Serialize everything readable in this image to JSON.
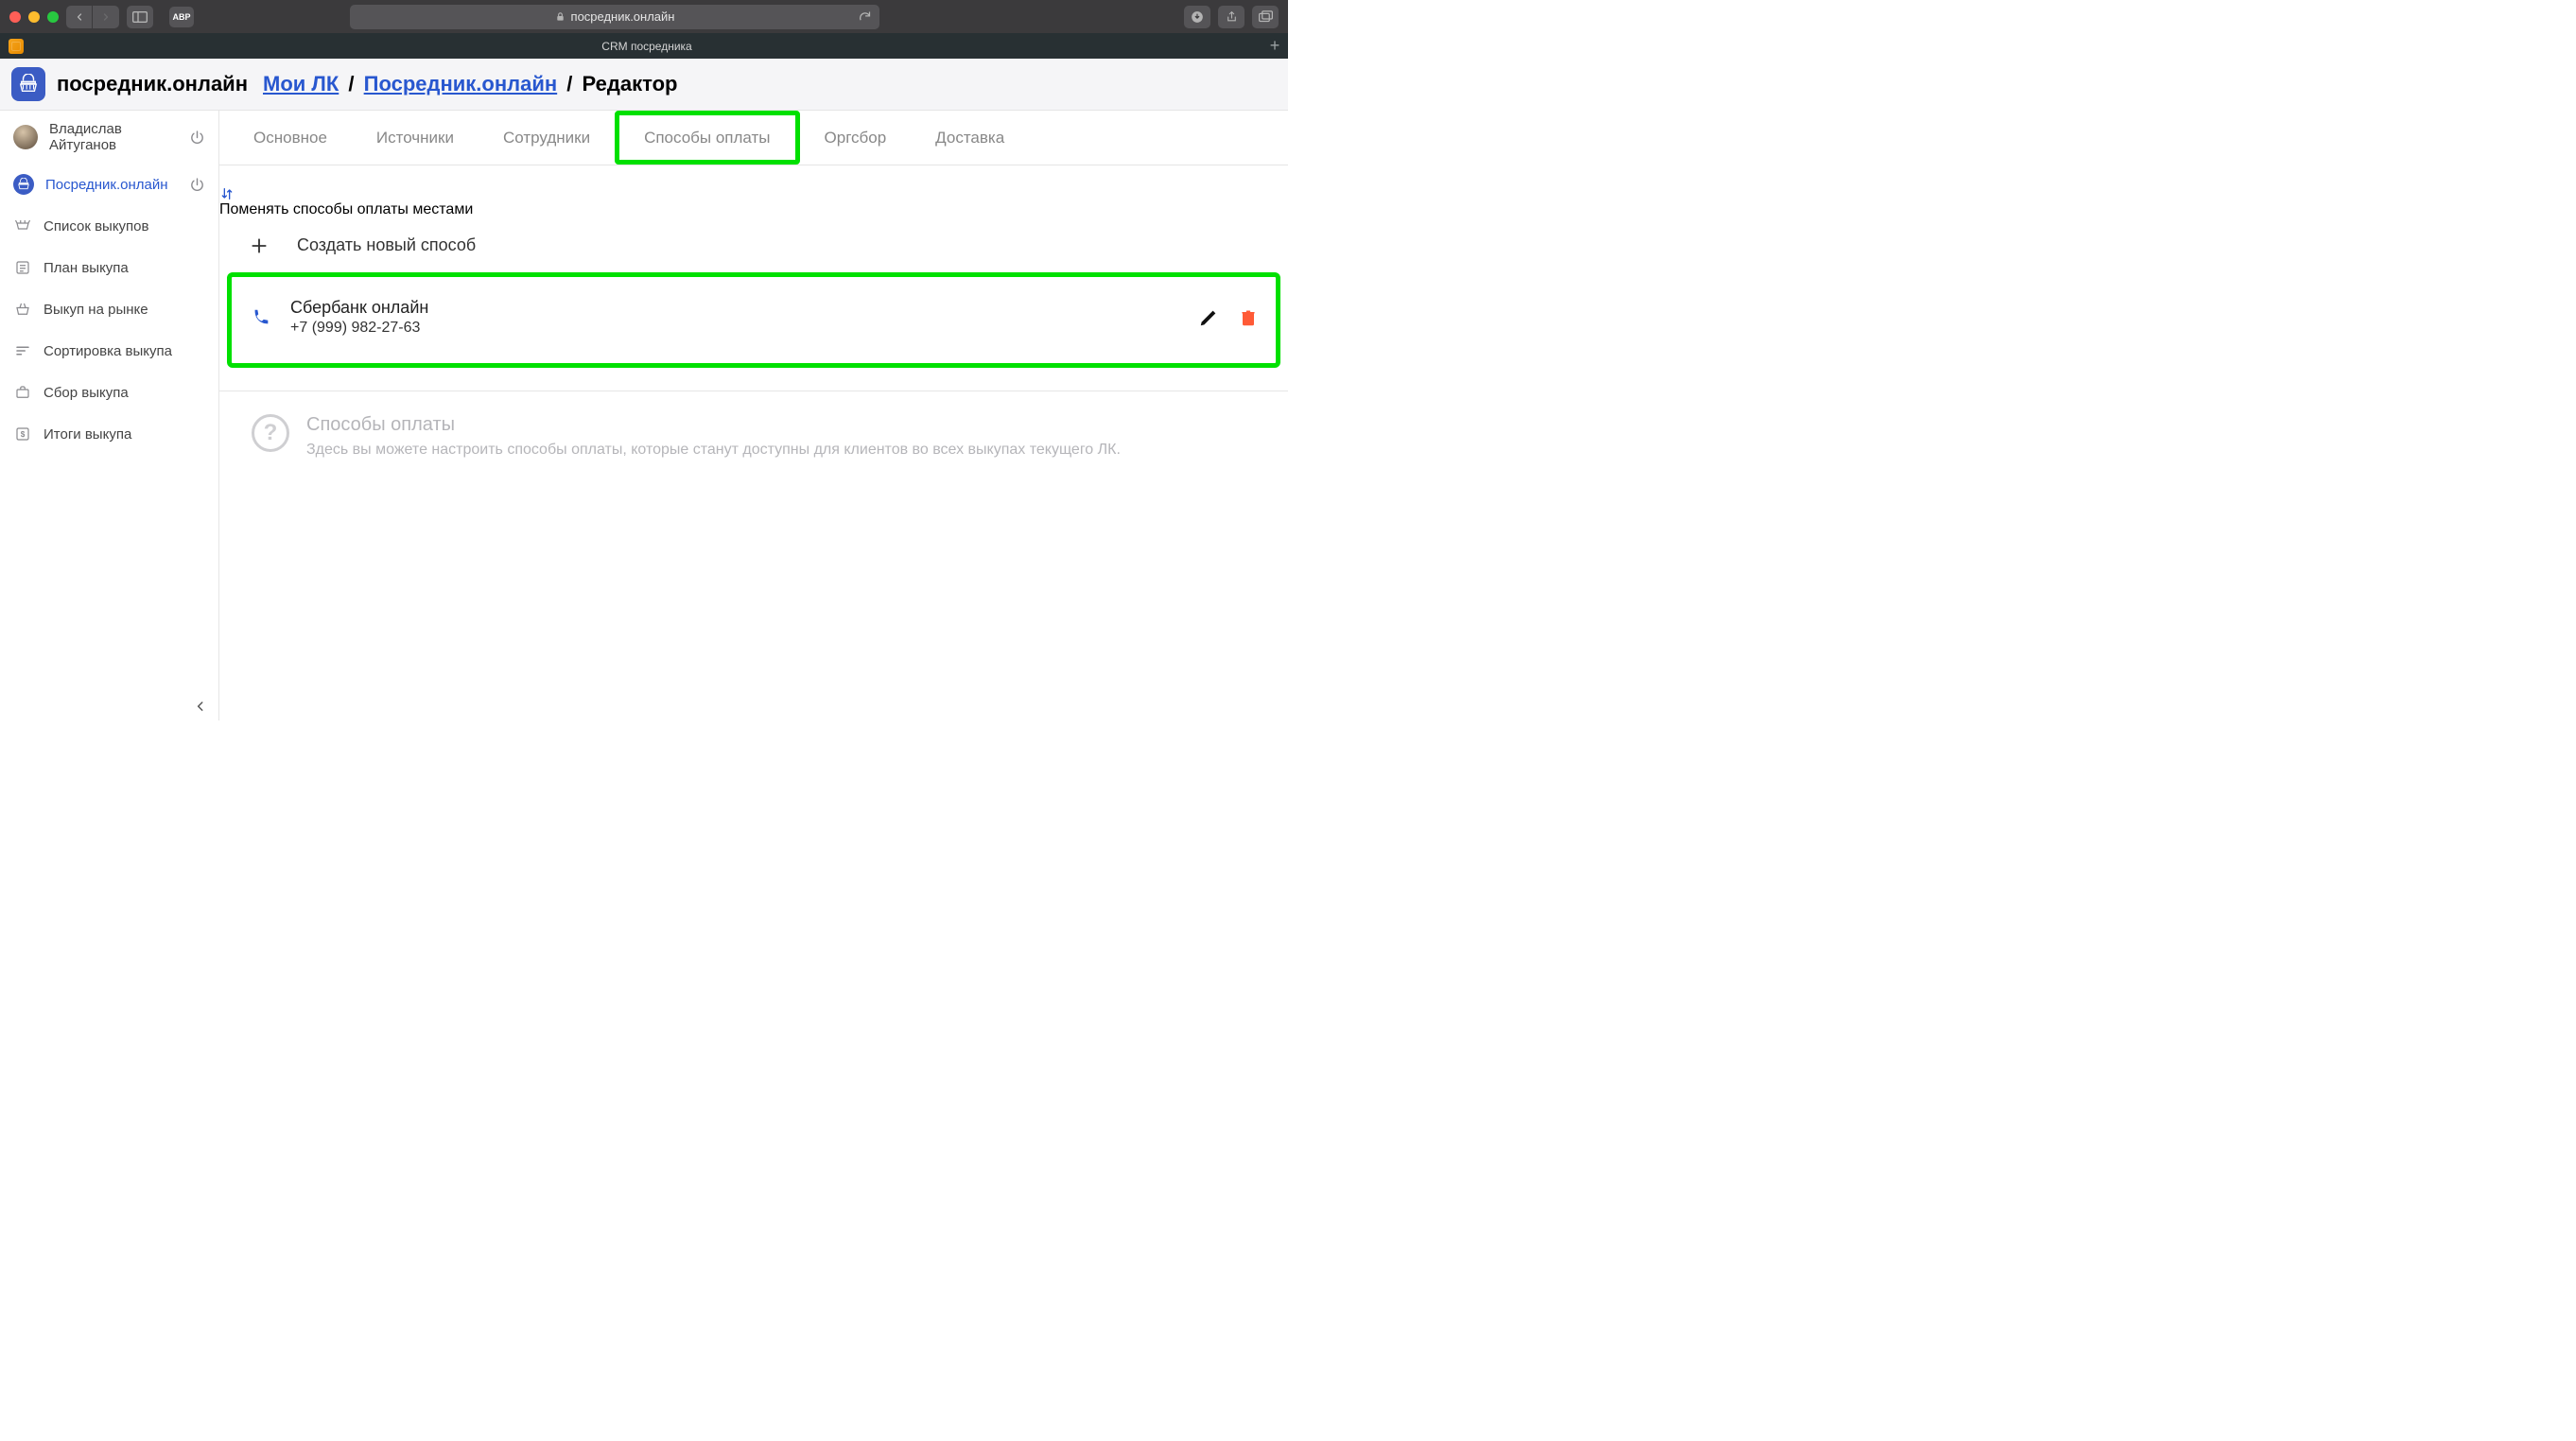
{
  "browser": {
    "url_display": "посредник.онлайн",
    "tab_title": "CRM посредника",
    "abp": "ABP"
  },
  "header": {
    "brand": "посредник.онлайн",
    "breadcrumb": {
      "root": "Мои ЛК",
      "mid": "Посредник.онлайн",
      "leaf": "Редактор"
    }
  },
  "sidebar": {
    "user_name": "Владислав Айтуганов",
    "items": [
      {
        "key": "posrednik",
        "label": "Посредник.онлайн",
        "active": true,
        "power": true
      },
      {
        "key": "list",
        "label": "Список выкупов"
      },
      {
        "key": "plan",
        "label": "План выкупа"
      },
      {
        "key": "market",
        "label": "Выкуп на рынке"
      },
      {
        "key": "sort",
        "label": "Сортировка выкупа"
      },
      {
        "key": "collect",
        "label": "Сбор выкупа"
      },
      {
        "key": "totals",
        "label": "Итоги выкупа"
      }
    ]
  },
  "tabs": [
    {
      "key": "main",
      "label": "Основное"
    },
    {
      "key": "sources",
      "label": "Источники"
    },
    {
      "key": "staff",
      "label": "Сотрудники"
    },
    {
      "key": "pay",
      "label": "Способы оплаты",
      "highlight": true
    },
    {
      "key": "orgfee",
      "label": "Оргсбор"
    },
    {
      "key": "delivery",
      "label": "Доставка"
    }
  ],
  "content": {
    "reorder_label": "Поменять способы оплаты местами",
    "create_label": "Создать новый способ",
    "payment": {
      "name": "Сбербанк онлайн",
      "sub": "+7 (999) 982-27-63"
    },
    "hint": {
      "title": "Способы оплаты",
      "text": "Здесь вы можете настроить способы оплаты, которые станут доступны для клиентов во всех выкупах текущего ЛК."
    }
  }
}
